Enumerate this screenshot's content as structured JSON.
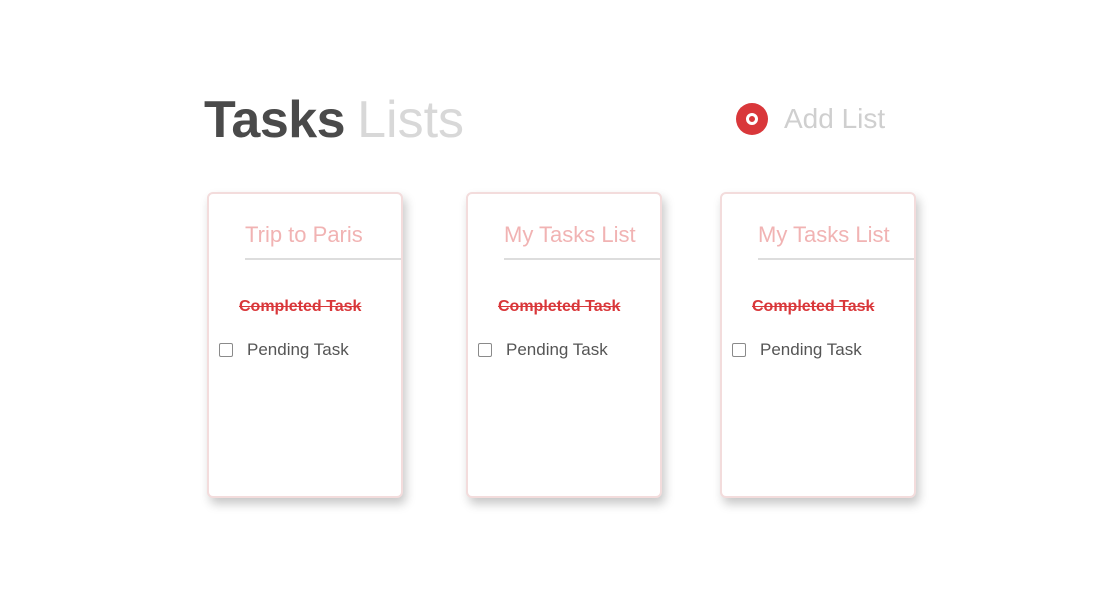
{
  "header": {
    "title_strong": "Tasks",
    "title_light": "Lists",
    "add_list_label": "Add List",
    "add_icon": "add-circle-icon"
  },
  "colors": {
    "accent": "#d9373a",
    "card_title": "#f1b3b3",
    "title_dark": "#4a4a4a",
    "title_light": "#d8d8d8"
  },
  "lists": [
    {
      "title": "Trip to Paris",
      "completed_task": "Completed Task",
      "pending_task": "Pending Task"
    },
    {
      "title": "My Tasks List",
      "completed_task": "Completed Task",
      "pending_task": "Pending Task"
    },
    {
      "title": "My Tasks List",
      "completed_task": "Completed Task",
      "pending_task": "Pending Task"
    }
  ]
}
